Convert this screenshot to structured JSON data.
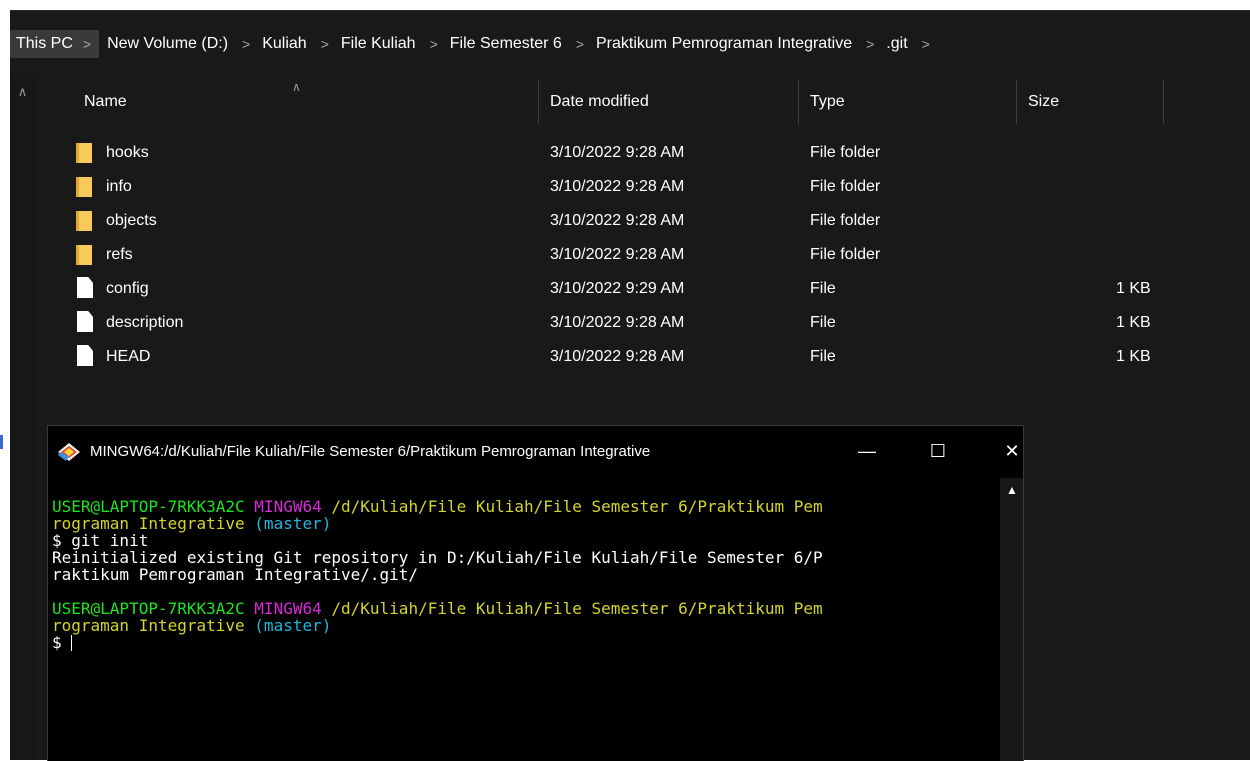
{
  "breadcrumb": {
    "items": [
      "This PC",
      "New Volume (D:)",
      "Kuliah",
      "File Kuliah",
      "File Semester 6",
      "Praktikum Pemrograman Integrative",
      ".git"
    ],
    "separator": ">"
  },
  "columns": {
    "name": "Name",
    "date": "Date modified",
    "type": "Type",
    "size": "Size"
  },
  "files": [
    {
      "name": "hooks",
      "date": "3/10/2022 9:28 AM",
      "type": "File folder",
      "size": "",
      "kind": "folder"
    },
    {
      "name": "info",
      "date": "3/10/2022 9:28 AM",
      "type": "File folder",
      "size": "",
      "kind": "folder"
    },
    {
      "name": "objects",
      "date": "3/10/2022 9:28 AM",
      "type": "File folder",
      "size": "",
      "kind": "folder"
    },
    {
      "name": "refs",
      "date": "3/10/2022 9:28 AM",
      "type": "File folder",
      "size": "",
      "kind": "folder"
    },
    {
      "name": "config",
      "date": "3/10/2022 9:29 AM",
      "type": "File",
      "size": "1 KB",
      "kind": "file"
    },
    {
      "name": "description",
      "date": "3/10/2022 9:28 AM",
      "type": "File",
      "size": "1 KB",
      "kind": "file"
    },
    {
      "name": "HEAD",
      "date": "3/10/2022 9:28 AM",
      "type": "File",
      "size": "1 KB",
      "kind": "file"
    }
  ],
  "terminal": {
    "title": "MINGW64:/d/Kuliah/File Kuliah/File Semester 6/Praktikum Pemrograman Integrative",
    "minimize": "—",
    "maximize": "☐",
    "close": "✕",
    "prompt1": {
      "user": "USER@LAPTOP-7RKK3A2C",
      "env": "MINGW64",
      "path_line1": "/d/Kuliah/File Kuliah/File Semester 6/Praktikum Pem",
      "path_line2": "rograman Integrative",
      "branch": "(master)"
    },
    "command": "$ git init",
    "output_line1": "Reinitialized existing Git repository in D:/Kuliah/File Kuliah/File Semester 6/P",
    "output_line2": "raktikum Pemrograman Integrative/.git/",
    "prompt2": {
      "user": "USER@LAPTOP-7RKK3A2C",
      "env": "MINGW64",
      "path_line1": "/d/Kuliah/File Kuliah/File Semester 6/Praktikum Pem",
      "path_line2": "rograman Integrative",
      "branch": "(master)"
    },
    "current_prompt": "$ "
  },
  "colors": {
    "background": "#191919",
    "terminal_background": "#000000",
    "user_green": "#1be51b",
    "env_magenta": "#d72bd7",
    "path_yellow": "#d4d42b",
    "branch_cyan": "#1fb8e0",
    "folder_yellow": "#f8c95b"
  },
  "icons": {
    "folder": "folder-icon",
    "file": "file-icon",
    "git": "git-bash-icon",
    "sort": "sort-up-icon"
  }
}
